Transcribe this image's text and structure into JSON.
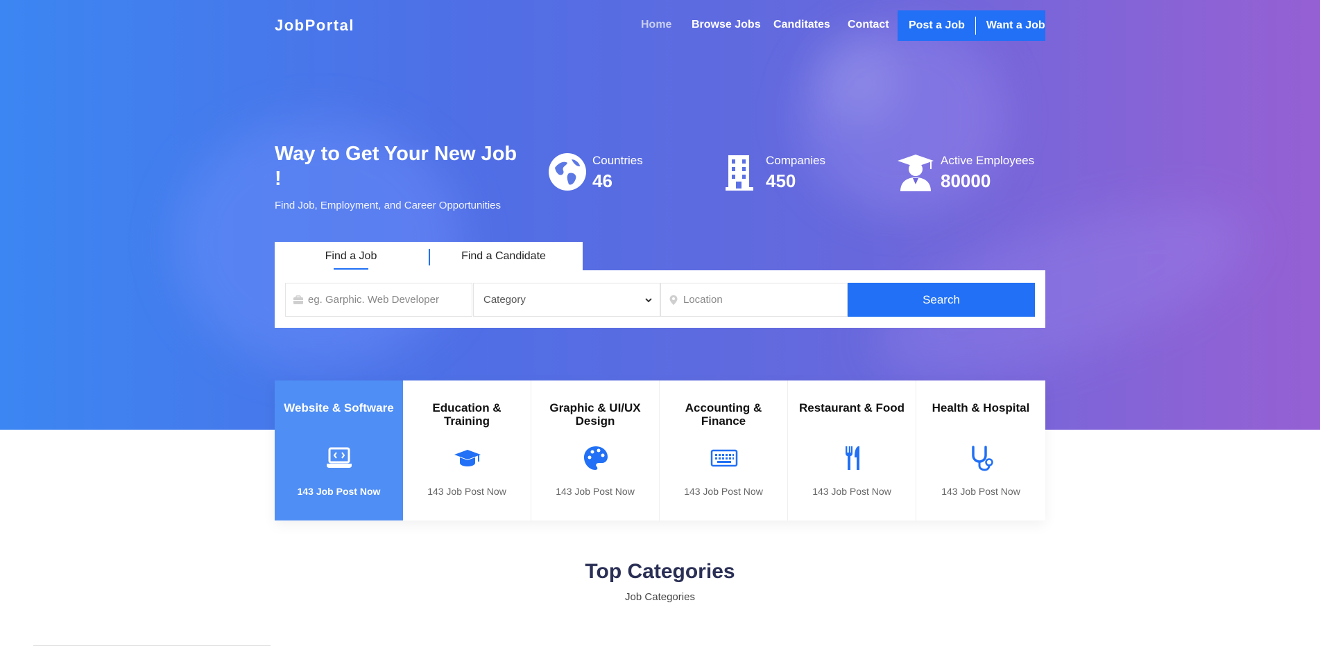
{
  "nav": {
    "brand": "JobPortal",
    "links": [
      {
        "label": "Home",
        "active": true
      },
      {
        "label": "Browse Jobs"
      },
      {
        "label": "Canditates"
      },
      {
        "label": "Contact"
      }
    ],
    "post_job": "Post a Job",
    "want_job": "Want a Job"
  },
  "hero": {
    "headline": "Way to Get Your New Job !",
    "subline": "Find Job, Employment, and Career Opportunities"
  },
  "stats": [
    {
      "icon": "globe-icon",
      "label": "Countries",
      "value": "46"
    },
    {
      "icon": "building-icon",
      "label": "Companies",
      "value": "450"
    },
    {
      "icon": "graduate-icon",
      "label": "Active Employees",
      "value": "80000"
    }
  ],
  "search": {
    "tabs": [
      "Find a Job",
      "Find a Candidate"
    ],
    "keyword_placeholder": "eg. Garphic. Web Developer",
    "category": "Category",
    "location_placeholder": "Location",
    "button": "Search"
  },
  "categories": [
    {
      "title": "Website & Software",
      "icon": "laptop-code-icon",
      "posts": "143 Job Post Now",
      "active": true
    },
    {
      "title": "Education & Training",
      "icon": "graduation-cap-icon",
      "posts": "143 Job Post Now"
    },
    {
      "title": "Graphic & UI/UX Design",
      "icon": "palette-icon",
      "posts": "143 Job Post Now"
    },
    {
      "title": "Accounting & Finance",
      "icon": "keyboard-icon",
      "posts": "143 Job Post Now"
    },
    {
      "title": "Restaurant & Food",
      "icon": "utensils-icon",
      "posts": "143 Job Post Now"
    },
    {
      "title": "Health & Hospital",
      "icon": "stethoscope-icon",
      "posts": "143 Job Post Now"
    }
  ],
  "top_categories": {
    "title": "Top Categories",
    "subtitle": "Job Categories"
  },
  "colors": {
    "accent": "#2170f5",
    "active_card": "#4f8ef5",
    "heading": "#2a2f55"
  }
}
